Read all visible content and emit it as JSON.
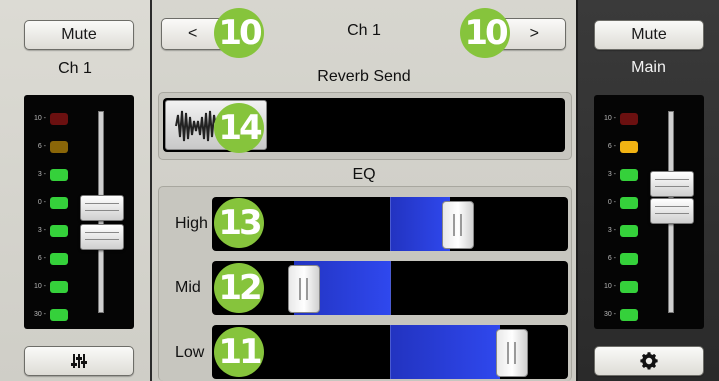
{
  "left": {
    "mute_label": "Mute",
    "channel_name": "Ch 1",
    "meter_labels": [
      "10",
      "6",
      "3",
      "0",
      "3",
      "6",
      "10",
      "30"
    ],
    "settings_icon": "sliders-icon"
  },
  "center": {
    "prev_label": "<",
    "next_label": ">",
    "channel_title": "Ch 1",
    "reverb_title": "Reverb Send",
    "eq_title": "EQ",
    "eq_bands": [
      {
        "label": "High",
        "badge": "13"
      },
      {
        "label": "Mid",
        "badge": "12"
      },
      {
        "label": "Low",
        "badge": "11"
      }
    ],
    "badges": {
      "prev": "10",
      "next": "10",
      "reverb": "14"
    }
  },
  "right": {
    "mute_label": "Mute",
    "channel_name": "Main",
    "meter_labels": [
      "10",
      "6",
      "3",
      "0",
      "3",
      "6",
      "10",
      "30"
    ],
    "settings_icon": "gear-icon"
  },
  "colors": {
    "led_green": "#35d13b",
    "led_red": "#6b1010",
    "led_amber_dim": "#8a6608",
    "led_amber": "#f1b313",
    "badge": "#86c43c",
    "eq_fill": "#2f48ee"
  }
}
